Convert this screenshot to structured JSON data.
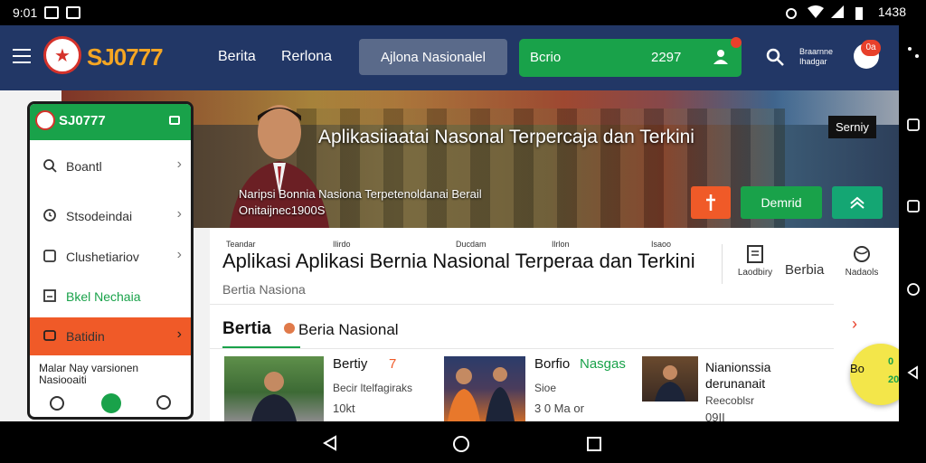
{
  "status_bar": {
    "time": "9:01",
    "battery": "1438"
  },
  "header": {
    "logo_text": "SJ0777",
    "nav": [
      "Berita",
      "Rerlona"
    ],
    "nav_pill": "Ajlona Nasionalel",
    "green_bar": {
      "label": "Bcrio",
      "number": "2297"
    },
    "small_text": [
      "Braarnne",
      "Ihadgar"
    ],
    "notif_count": "0a"
  },
  "hero": {
    "title": "Aplikasiiaatai Nasonal Terpercaja dan Terkini",
    "subtitle": "Naripsi Bonnia Nasiona Terpetenoldanai Berail",
    "subtitle2": "Onitaijnec1900S",
    "tag": "Serniy",
    "btn_green": "Demrid",
    "icon_colors": {
      "orange": "#f05a28",
      "green": "#19a24a",
      "teal": "#14a673"
    }
  },
  "content": {
    "cats": [
      "Teandar",
      "Ilirdo",
      "Ducdam",
      "Ilrlon",
      "Isaoo"
    ],
    "title": "Aplikasi Aplikasi Bernia Nasional Terperaa dan Terkini",
    "subtitle": "Bertia Nasiona",
    "right_icons": [
      "Laodbiry",
      "Nadaols"
    ],
    "right_big": "Berbia",
    "section_title": "Bertia",
    "section_title2": "Beria Nasional",
    "news": [
      {
        "t1": "Bertiy",
        "t1b": "7",
        "t2": "Becir ltelfagiraks",
        "t3": "10kt"
      },
      {
        "t1": "Borfio",
        "t1b": "Nasgas",
        "t2": "Sioe",
        "t3": "3 0 Ma or"
      },
      {
        "t1": "Nianionssia",
        "t1b": "derunanait",
        "t2": "Reecoblsr",
        "t3": "09II"
      }
    ]
  },
  "phone": {
    "title": "SJ0777",
    "items": [
      {
        "label": "Boantl"
      },
      {
        "label": "Stsodeindai"
      },
      {
        "label": "Clushetiariov"
      },
      {
        "label": "Bkel Nechaia"
      },
      {
        "label": "Batidin"
      }
    ],
    "footer": [
      "Malar Nay varsionen",
      "Nasiooaiti"
    ]
  },
  "fab": {
    "a": "Bo",
    "b": "0",
    "c": "20"
  },
  "colors": {
    "header": "#223766",
    "accent_green": "#19a24a",
    "accent_orange": "#f05a28",
    "logo": "#f5a623"
  }
}
